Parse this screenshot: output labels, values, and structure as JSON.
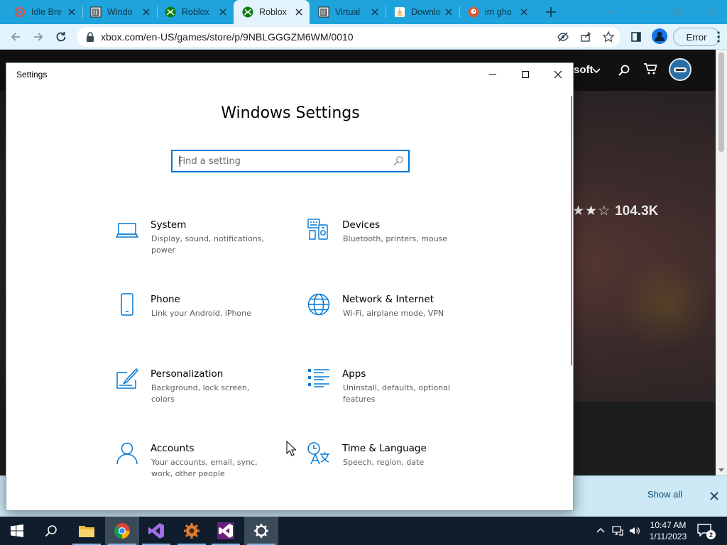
{
  "browser": {
    "tabs": [
      {
        "title": "Idle Bre",
        "favicon": "idle-breakout-icon",
        "favicon_color": "#e84d3d",
        "active": false
      },
      {
        "title": "Windo",
        "favicon": "library-icon",
        "favicon_color": "#222222",
        "active": false
      },
      {
        "title": "Roblox",
        "favicon": "xbox-icon",
        "favicon_color": "#107c10",
        "active": false
      },
      {
        "title": "Roblox",
        "favicon": "xbox-icon",
        "favicon_color": "#107c10",
        "active": true
      },
      {
        "title": "Virtual",
        "favicon": "library-icon",
        "favicon_color": "#222222",
        "active": false
      },
      {
        "title": "Downlo",
        "favicon": "download-page-icon",
        "favicon_color": "#f2a33a",
        "active": false
      },
      {
        "title": "im gho",
        "favicon": "duckduckgo-icon",
        "favicon_color": "#de5833",
        "active": false
      }
    ],
    "url": "xbox.com/en-US/games/store/p/9NBLGGGZM6WM/0010",
    "profile_error_label": "Error",
    "accent": "#1ea3dc"
  },
  "webpage": {
    "brand_fragment": "soft",
    "rating_stars": "★★☆",
    "rating_count": "104.3K"
  },
  "download_bar": {
    "show_all_label": "Show all"
  },
  "settings": {
    "window_title": "Settings",
    "heading": "Windows Settings",
    "search_placeholder": "Find a setting",
    "accent": "#0078d7",
    "categories": [
      {
        "name": "System",
        "description": "Display, sound, notifications, power",
        "icon": "laptop-icon"
      },
      {
        "name": "Devices",
        "description": "Bluetooth, printers, mouse",
        "icon": "devices-icon"
      },
      {
        "name": "Phone",
        "description": "Link your Android, iPhone",
        "icon": "phone-icon"
      },
      {
        "name": "Network & Internet",
        "description": "Wi-Fi, airplane mode, VPN",
        "icon": "globe-icon"
      },
      {
        "name": "Personalization",
        "description": "Background, lock screen, colors",
        "icon": "paint-pen-icon"
      },
      {
        "name": "Apps",
        "description": "Uninstall, defaults, optional features",
        "icon": "apps-list-icon"
      },
      {
        "name": "Accounts",
        "description": "Your accounts, email, sync, work, other people",
        "icon": "person-icon"
      },
      {
        "name": "Time & Language",
        "description": "Speech, region, date",
        "icon": "time-language-icon"
      }
    ]
  },
  "taskbar": {
    "time": "10:47 AM",
    "date": "1/11/2023",
    "notification_count": "2"
  }
}
